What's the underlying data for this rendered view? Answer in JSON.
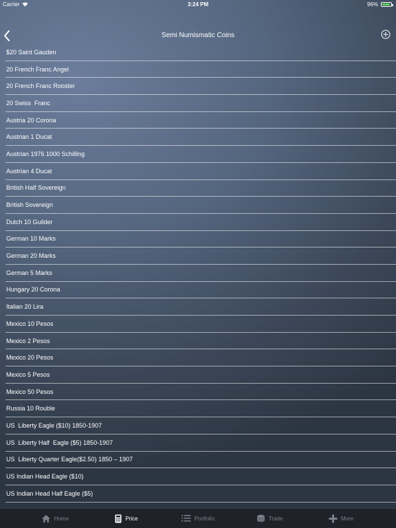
{
  "status": {
    "carrier": "Carrier",
    "time": "3:24 PM",
    "battery": "96%"
  },
  "nav": {
    "title": "Semi Numismatic Coins"
  },
  "coins": [
    "$20 Saint Gauden",
    "20 French Franc Angel",
    "20 French Franc Rooster",
    "20 Swiss  Franc",
    "Austria 20 Corona",
    "Austrian 1 Ducat",
    "Austrian 1976 1000 Schilling",
    "Austrian 4 Ducat",
    "British Half Sovereign",
    "British Sovereign",
    "Dutch 10 Guilder",
    "German 10 Marks",
    "German 20 Marks",
    "German 5 Marks",
    "Hungary 20 Corona",
    "Italian 20 Lira",
    "Mexico 10 Pesos",
    "Mexico 2 Pesos",
    "Mexico 20 Pesos",
    "Mexico 5 Pesos",
    "Mexico 50 Pesos",
    "Russia 10 Rouble",
    "US  Liberty Eagle ($10) 1850-1907",
    "US  Liberty Half  Eagle ($5) 1850-1907",
    "US  Liberty Quarter Eagle($2.50) 1850 – 1907",
    "US Indian Head Eagle ($10)",
    "US Indian Head Half Eagle ($5)"
  ],
  "tabs": [
    {
      "label": "Home",
      "icon": "home-icon"
    },
    {
      "label": "Price",
      "icon": "calculator-icon"
    },
    {
      "label": "Portfolio",
      "icon": "list-icon"
    },
    {
      "label": "Trade",
      "icon": "coins-icon"
    },
    {
      "label": "More",
      "icon": "plus-icon"
    }
  ],
  "active_tab": "Price",
  "colors": {
    "battery": "#5fd35f",
    "tab_bar": "#1f2329",
    "tab_inactive": "#7b8089"
  }
}
